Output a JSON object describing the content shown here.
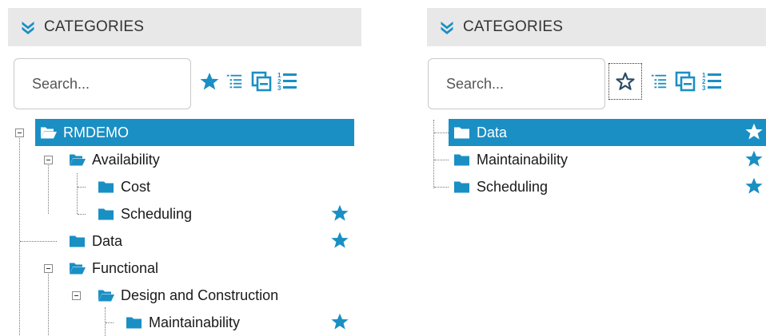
{
  "colors": {
    "accent": "#1a8fc4",
    "header_bg": "#e8e8e8",
    "selected_text": "#ffffff"
  },
  "left_panel": {
    "header": {
      "title": "CATEGORIES",
      "icon": "double-chevron-down-icon"
    },
    "search": {
      "placeholder": "Search..."
    },
    "toolbar": [
      "favorites-star-filled-icon",
      "indented-list-icon",
      "collapse-windows-icon",
      "numbered-list-icon"
    ],
    "tree": [
      {
        "label": "RMDEMO",
        "selected": true,
        "favorite": false
      },
      {
        "label": "Availability",
        "favorite": false
      },
      {
        "label": "Cost",
        "favorite": false
      },
      {
        "label": "Scheduling",
        "favorite": true
      },
      {
        "label": "Data",
        "favorite": true
      },
      {
        "label": "Functional",
        "favorite": false
      },
      {
        "label": "Design and Construction",
        "favorite": false
      },
      {
        "label": "Maintainability",
        "favorite": true
      }
    ]
  },
  "right_panel": {
    "header": {
      "title": "CATEGORIES",
      "icon": "double-chevron-down-icon"
    },
    "search": {
      "placeholder": "Search..."
    },
    "toolbar": [
      "favorites-star-outline-icon",
      "indented-list-icon",
      "collapse-windows-icon",
      "numbered-list-icon"
    ],
    "tree": [
      {
        "label": "Data",
        "selected": true,
        "favorite": true
      },
      {
        "label": "Maintainability",
        "favorite": true
      },
      {
        "label": "Scheduling",
        "favorite": true
      }
    ]
  }
}
